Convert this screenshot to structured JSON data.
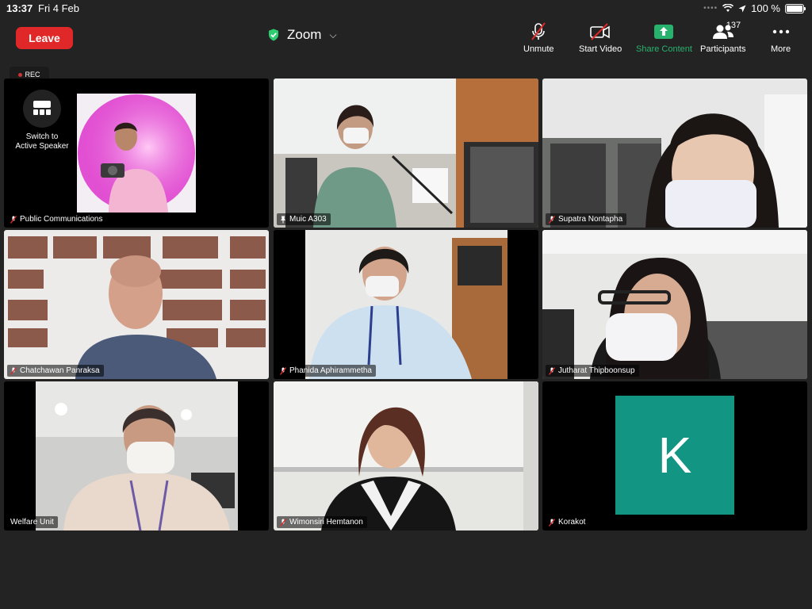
{
  "status_bar": {
    "time": "13:37",
    "date": "Fri 4 Feb",
    "battery": "100 %"
  },
  "toolbar": {
    "leave_label": "Leave",
    "meeting_title": "Zoom",
    "unmute_label": "Unmute",
    "start_video_label": "Start Video",
    "share_content_label": "Share Content",
    "participants_label": "Participants",
    "participants_count": "137",
    "more_label": "More"
  },
  "rec_label": "REC",
  "switch_label_1": "Switch to",
  "switch_label_2": "Active Speaker",
  "tiles": [
    {
      "name": "Public Communications",
      "muted": true
    },
    {
      "name": "Muic A303",
      "pinned": true
    },
    {
      "name": "Supatra Nontapha",
      "muted": true
    },
    {
      "name": "Chatchawan Panraksa",
      "muted": true
    },
    {
      "name": "Phanida Aphirammetha",
      "muted": true
    },
    {
      "name": "Jutharat Thipboonsup",
      "muted": true
    },
    {
      "name": "Welfare Unit",
      "muted": false
    },
    {
      "name": "Wimonsiri Hemtanon",
      "muted": true
    },
    {
      "name": "Korakot",
      "muted": true,
      "initial": "K"
    }
  ],
  "colors": {
    "leave": "#e02828",
    "share": "#27b36d",
    "active_border": "#2ecc71",
    "avatar_k": "#129683"
  }
}
